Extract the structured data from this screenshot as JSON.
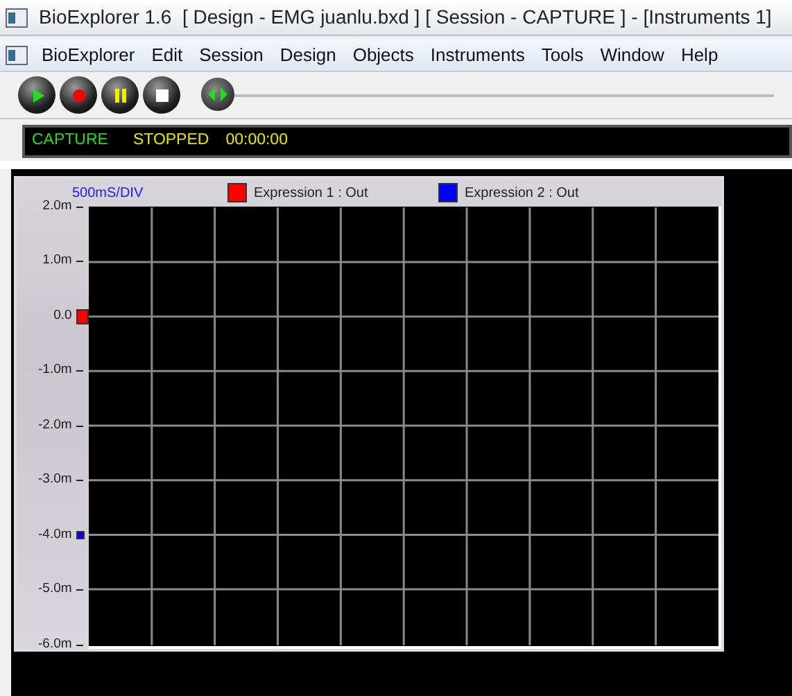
{
  "window": {
    "title": "BioExplorer 1.6  [ Design - EMG juanlu.bxd ] [ Session - CAPTURE ] - [Instruments 1]"
  },
  "menu": [
    "BioExplorer",
    "Edit",
    "Session",
    "Design",
    "Objects",
    "Instruments",
    "Tools",
    "Window",
    "Help"
  ],
  "toolbar": {
    "buttons": [
      {
        "kind": "play"
      },
      {
        "kind": "record"
      },
      {
        "kind": "pause"
      },
      {
        "kind": "stop"
      }
    ],
    "slider": {
      "level": 0
    }
  },
  "status": {
    "mode": "CAPTURE",
    "state": "STOPPED",
    "time": "00:00:00"
  },
  "scope": {
    "time_base": "500mS/DIV",
    "legend": [
      {
        "label": "Expression 1 : Out",
        "color": "#ff0000"
      },
      {
        "label": "Expression 2 : Out",
        "color": "#0000ff"
      }
    ],
    "y_labels": [
      {
        "text": "2.0m"
      },
      {
        "text": "1.0m"
      },
      {
        "text": "0.0",
        "color": "#ff0000"
      },
      {
        "text": "-1.0m"
      },
      {
        "text": "-2.0m"
      },
      {
        "text": "-3.0m"
      },
      {
        "text": "-4.0m",
        "color": "#0000ff"
      },
      {
        "text": "-5.0m"
      },
      {
        "text": "-6.0m"
      }
    ]
  }
}
